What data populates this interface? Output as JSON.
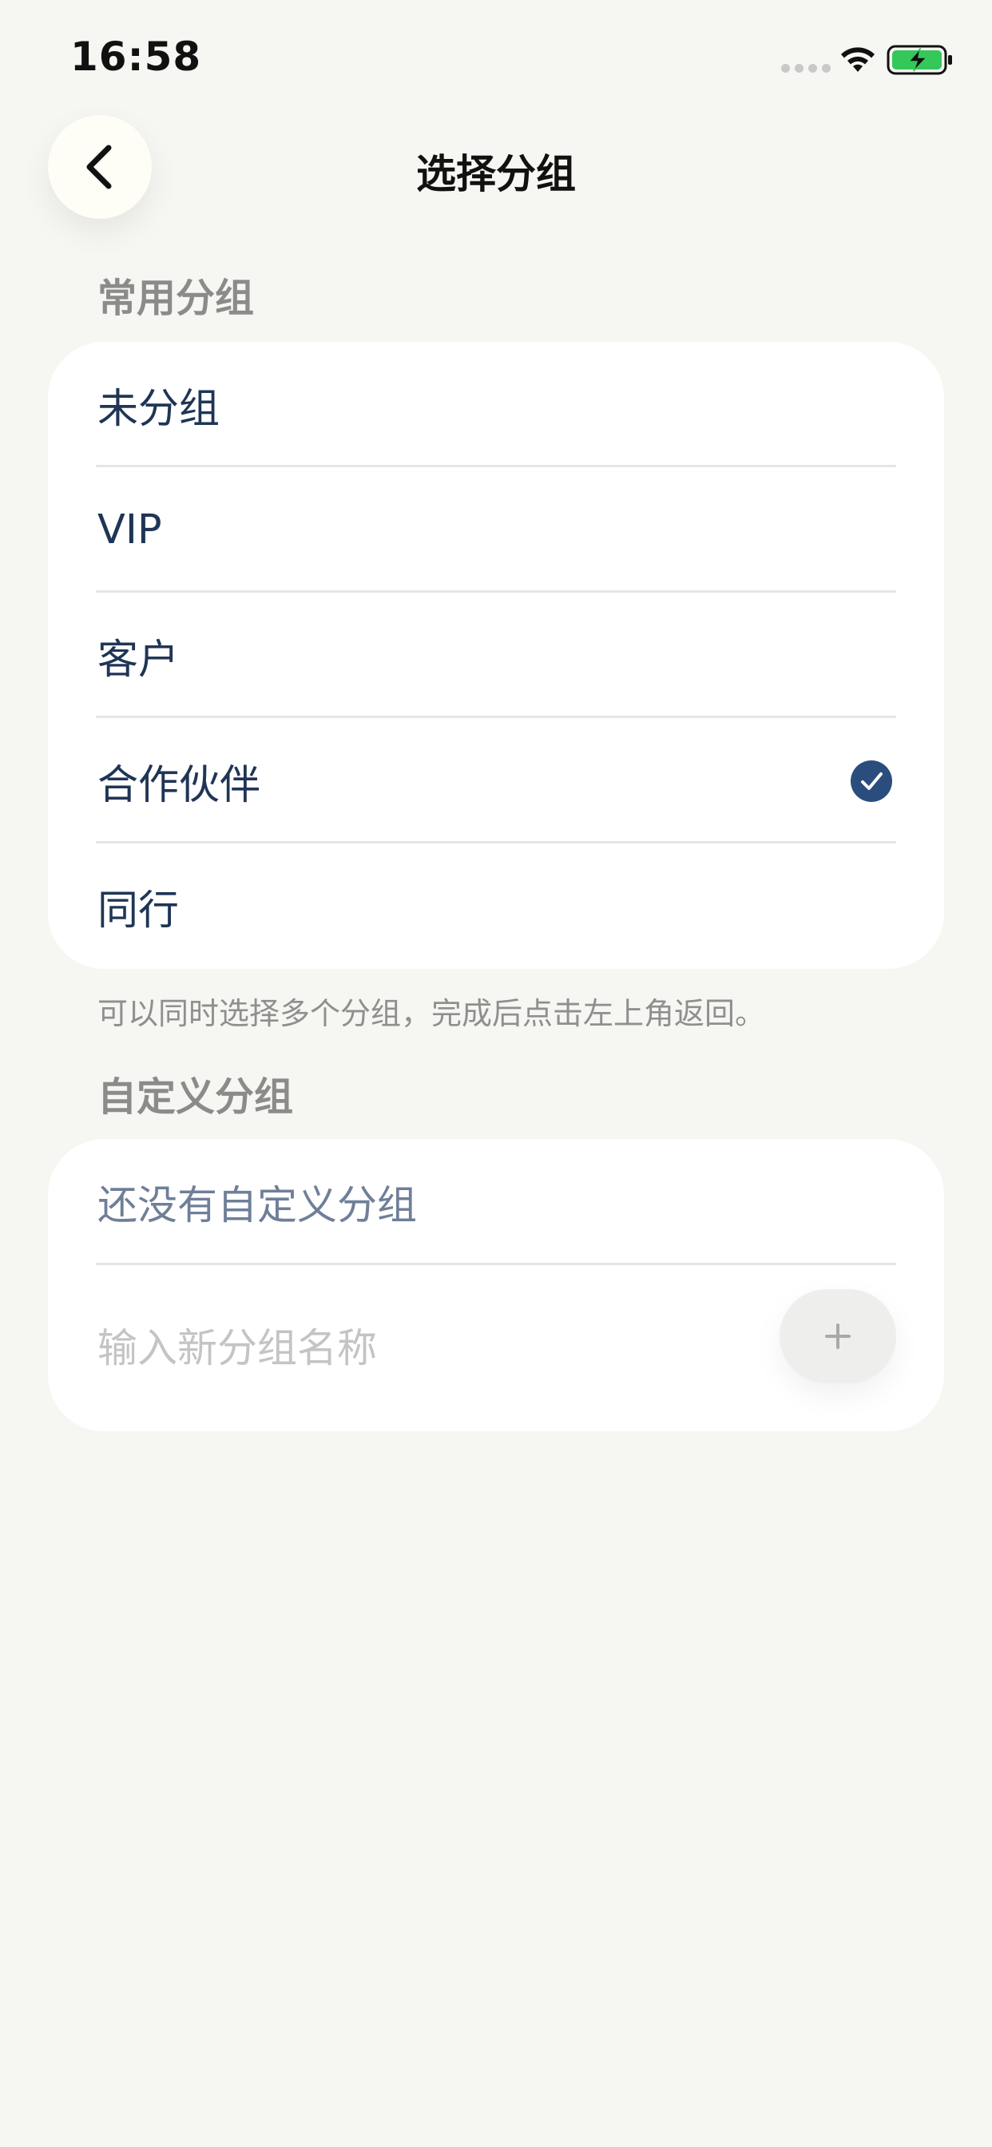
{
  "status_bar": {
    "time": "16:58"
  },
  "nav": {
    "title": "选择分组",
    "back_icon": "chevron-left-icon"
  },
  "common_section": {
    "label": "常用分组",
    "items": [
      {
        "label": "未分组",
        "selected": false
      },
      {
        "label": "VIP",
        "selected": false
      },
      {
        "label": "客户",
        "selected": false
      },
      {
        "label": "合作伙伴",
        "selected": true
      },
      {
        "label": "同行",
        "selected": false
      }
    ],
    "hint": "可以同时选择多个分组，完成后点击左上角返回。"
  },
  "custom_section": {
    "label": "自定义分组",
    "empty_text": "还没有自定义分组",
    "input_value": "",
    "input_placeholder": "输入新分组名称",
    "add_icon": "plus-icon"
  },
  "colors": {
    "background": "#f6f6f2",
    "card": "#ffffff",
    "text_primary": "#1f3556",
    "checkmark": "#2b4d7e",
    "battery_green": "#34c759"
  }
}
